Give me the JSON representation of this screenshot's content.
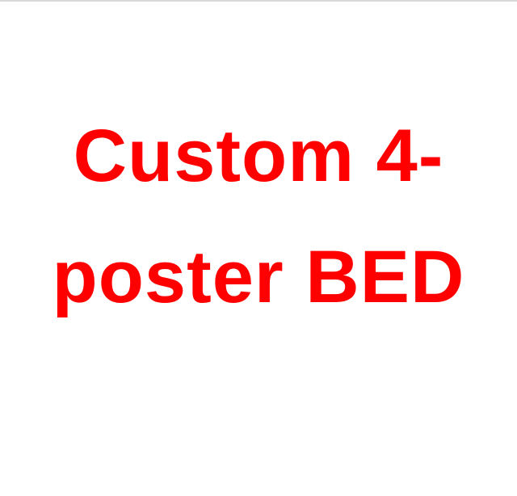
{
  "headline": {
    "line1": "Custom 4-",
    "line2": "poster BED",
    "color": "#ff0000"
  },
  "background_color": "#ffffff"
}
